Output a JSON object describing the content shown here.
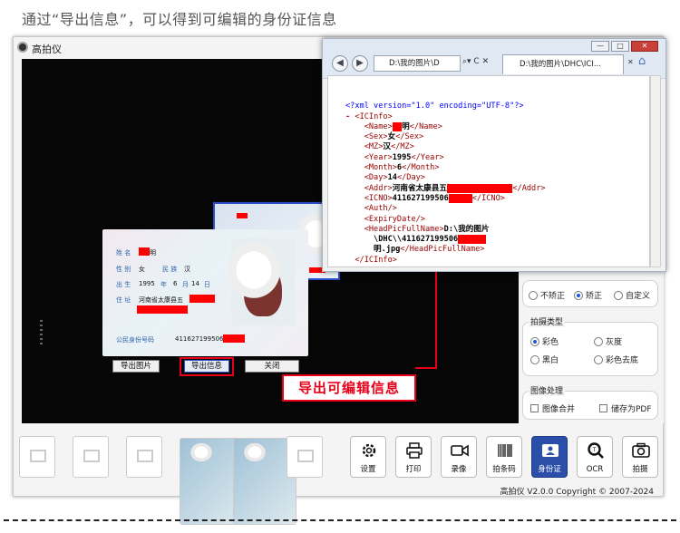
{
  "headline": "通过“导出信息”，可以得到可编辑的身份证信息",
  "app": {
    "title": "高拍仪",
    "version": "高拍仪 V2.0.0 Copyright © 2007-2024"
  },
  "correction": {
    "options": [
      "不矫正",
      "矫正",
      "自定义"
    ],
    "selected": "矫正"
  },
  "capture_type": {
    "title": "拍摄类型",
    "options": [
      "彩色",
      "灰度",
      "黑白",
      "彩色去底"
    ],
    "selected": "彩色"
  },
  "image_processing": {
    "title": "图像处理",
    "options": [
      "图像合并",
      "储存为PDF"
    ]
  },
  "tools": [
    {
      "label": "设置",
      "icon": "gear-icon"
    },
    {
      "label": "打印",
      "icon": "printer-icon"
    },
    {
      "label": "录像",
      "icon": "video-camera-icon"
    },
    {
      "label": "拍条码",
      "icon": "barcode-icon"
    },
    {
      "label": "身份证",
      "icon": "id-card-icon",
      "active": true
    },
    {
      "label": "OCR",
      "icon": "ocr-magnifier-icon"
    },
    {
      "label": "拍摄",
      "icon": "camera-icon"
    }
  ],
  "id_card": {
    "name_label": "姓 名",
    "name_value": "明",
    "sex_label": "性 别",
    "sex_value": "女",
    "nation_label": "民 族",
    "nation_value": "汉",
    "birth_label": "出 生",
    "birth_year": "1995",
    "year_char": "年",
    "birth_month": "6",
    "month_char": "月",
    "birth_day": "14",
    "day_char": "日",
    "addr_label": "住 址",
    "addr_value": "河南省太康县五",
    "idno_label": "公民身份号码",
    "idno_value": "4116271995061"
  },
  "dialog_buttons": {
    "export_image": "导出图片",
    "export_info": "导出信息",
    "close": "关闭"
  },
  "callout": "导出可编辑信息",
  "browser": {
    "address": "D:\\我的图片\\D",
    "tab": "D:\\我的图片\\DHC\\ICI...",
    "xml_decl": "<?xml version=\"1.0\" encoding=\"UTF-8\"?>",
    "root_tag": "ICInfo",
    "fields": {
      "name": "明",
      "sex": "女",
      "mz": "汉",
      "year": "1995",
      "month": "6",
      "day": "14",
      "addr": "河南省太康县五",
      "icno": "411627199506",
      "headpic_line1": "D:\\我的图片",
      "headpic_line2": "\\DHC\\\\411627199506",
      "headpic_line3": "明.jpg"
    }
  }
}
